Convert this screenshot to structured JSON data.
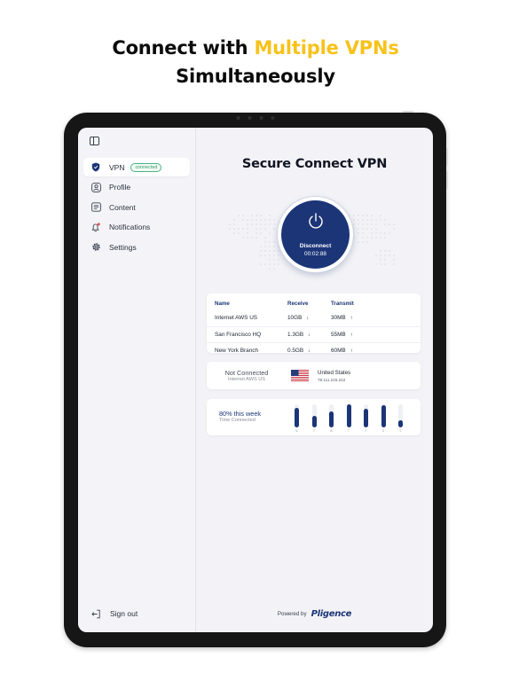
{
  "headline": {
    "line1_prefix": "Connect with ",
    "line1_highlight": "Multiple VPNs",
    "line2": "Simultaneously"
  },
  "colors": {
    "accent_yellow": "#f7c21a",
    "brand_navy": "#1b3577",
    "connected_green": "#48b383"
  },
  "sidebar": {
    "toggle_icon": "sidebar-toggle-icon",
    "items": [
      {
        "label": "VPN",
        "icon": "shield-icon",
        "badge": "connected",
        "active": true
      },
      {
        "label": "Profile",
        "icon": "user-icon"
      },
      {
        "label": "Content",
        "icon": "document-icon"
      },
      {
        "label": "Notifications",
        "icon": "bell-icon"
      },
      {
        "label": "Settings",
        "icon": "gear-icon"
      }
    ],
    "signout_label": "Sign out"
  },
  "main": {
    "title": "Secure Connect VPN",
    "power_button": {
      "label": "Disconnect",
      "timer": "00:02:88"
    },
    "table": {
      "headers": [
        "Name",
        "Receive",
        "Transmit"
      ],
      "rows": [
        {
          "name": "Internet AWS US",
          "receive": "10GB",
          "transmit": "30MB"
        },
        {
          "name": "San Francisco HQ",
          "receive": "1.3GB",
          "transmit": "55MB"
        },
        {
          "name": "New York Branch",
          "receive": "0.5GB",
          "transmit": "60MB"
        }
      ]
    },
    "connection": {
      "status": "Not Connected",
      "server": "Internet AWS US",
      "country": "United States",
      "ip": "78.111.215.242"
    },
    "weekly": {
      "percent_label": "80% this week",
      "sub_label": "Time Connected",
      "days": [
        "M",
        "T",
        "W",
        "T",
        "F",
        "S",
        "S"
      ],
      "levels": [
        0.85,
        0.5,
        0.7,
        1.0,
        0.82,
        0.96,
        0.3
      ]
    },
    "footer": {
      "powered_by": "Powered by",
      "brand": "Pligence"
    }
  }
}
